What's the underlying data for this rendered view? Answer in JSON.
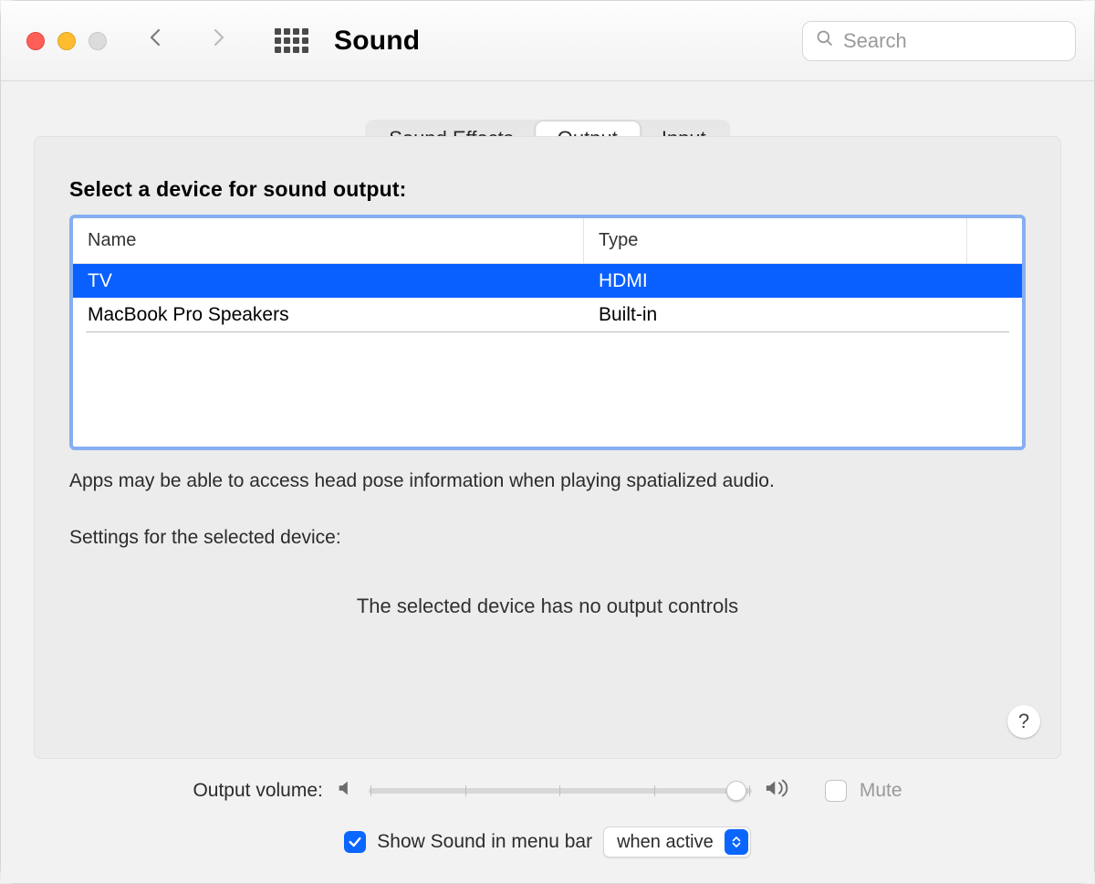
{
  "header": {
    "title": "Sound",
    "search_placeholder": "Search"
  },
  "tabs": {
    "effects": "Sound Effects",
    "output": "Output",
    "input": "Input",
    "active": "output"
  },
  "main": {
    "select_label": "Select a device for sound output:",
    "columns": {
      "name": "Name",
      "type": "Type"
    },
    "devices": [
      {
        "name": "TV",
        "type": "HDMI",
        "selected": true
      },
      {
        "name": "MacBook Pro Speakers",
        "type": "Built-in",
        "selected": false
      }
    ],
    "spatial_hint": "Apps may be able to access head pose information when playing spatialized audio.",
    "settings_for_label": "Settings for the selected device:",
    "no_controls": "The selected device has no output controls",
    "help_symbol": "?"
  },
  "footer": {
    "volume_label": "Output volume:",
    "volume_percent": 96,
    "mute_label": "Mute",
    "mute_checked": false,
    "show_in_menu_label": "Show Sound in menu bar",
    "show_in_menu_checked": true,
    "popup_value": "when active"
  }
}
